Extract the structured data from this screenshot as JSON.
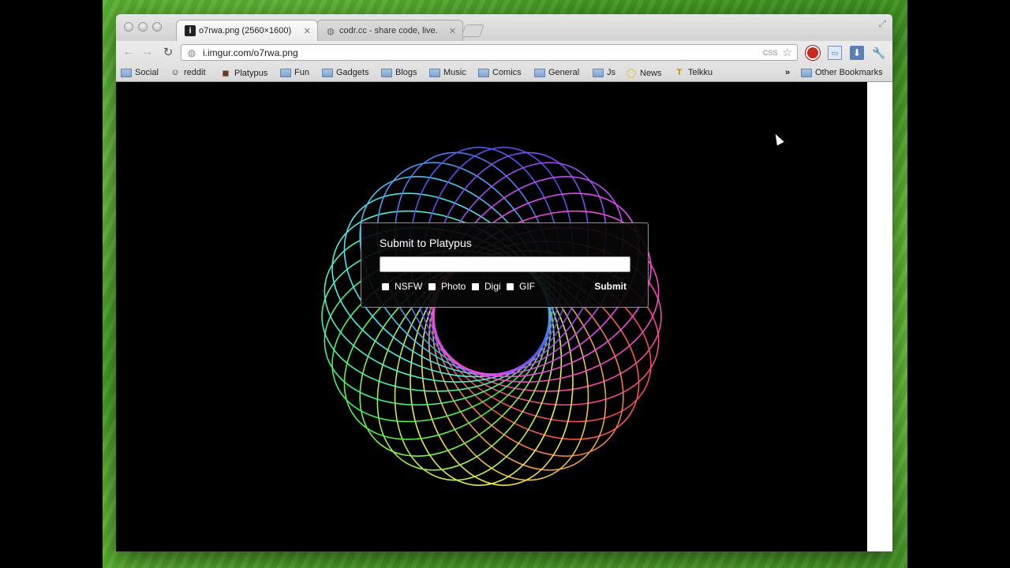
{
  "tabs": [
    {
      "title": "o7rwa.png (2560×1600)",
      "favicon": "i",
      "close": "✕"
    },
    {
      "title": "codr.cc - share code, live.",
      "favicon": "◍",
      "close": "✕"
    }
  ],
  "toolbar": {
    "back": "←",
    "forward": "→",
    "reload": "↻",
    "url": "i.imgur.com/o7rwa.png",
    "css_badge": "CSS"
  },
  "bookmarks": [
    {
      "label": "Social",
      "kind": "folder"
    },
    {
      "label": "reddit",
      "kind": "site",
      "glyph": "☺"
    },
    {
      "label": "Platypus",
      "kind": "site",
      "glyph": "◼"
    },
    {
      "label": "Fun",
      "kind": "folder"
    },
    {
      "label": "Gadgets",
      "kind": "folder"
    },
    {
      "label": "Blogs",
      "kind": "folder"
    },
    {
      "label": "Music",
      "kind": "folder"
    },
    {
      "label": "Comics",
      "kind": "folder"
    },
    {
      "label": "General",
      "kind": "folder"
    },
    {
      "label": "Js",
      "kind": "folder"
    },
    {
      "label": "News",
      "kind": "site",
      "glyph": "◯"
    },
    {
      "label": "Telkku",
      "kind": "site",
      "glyph": "T"
    }
  ],
  "bookmarks_overflow": "»",
  "other_bookmarks": "Other Bookmarks",
  "dialog": {
    "title": "Submit to Platypus",
    "field_value": "",
    "options": [
      "NSFW",
      "Photo",
      "Digi",
      "GIF"
    ],
    "submit_label": "Submit"
  }
}
